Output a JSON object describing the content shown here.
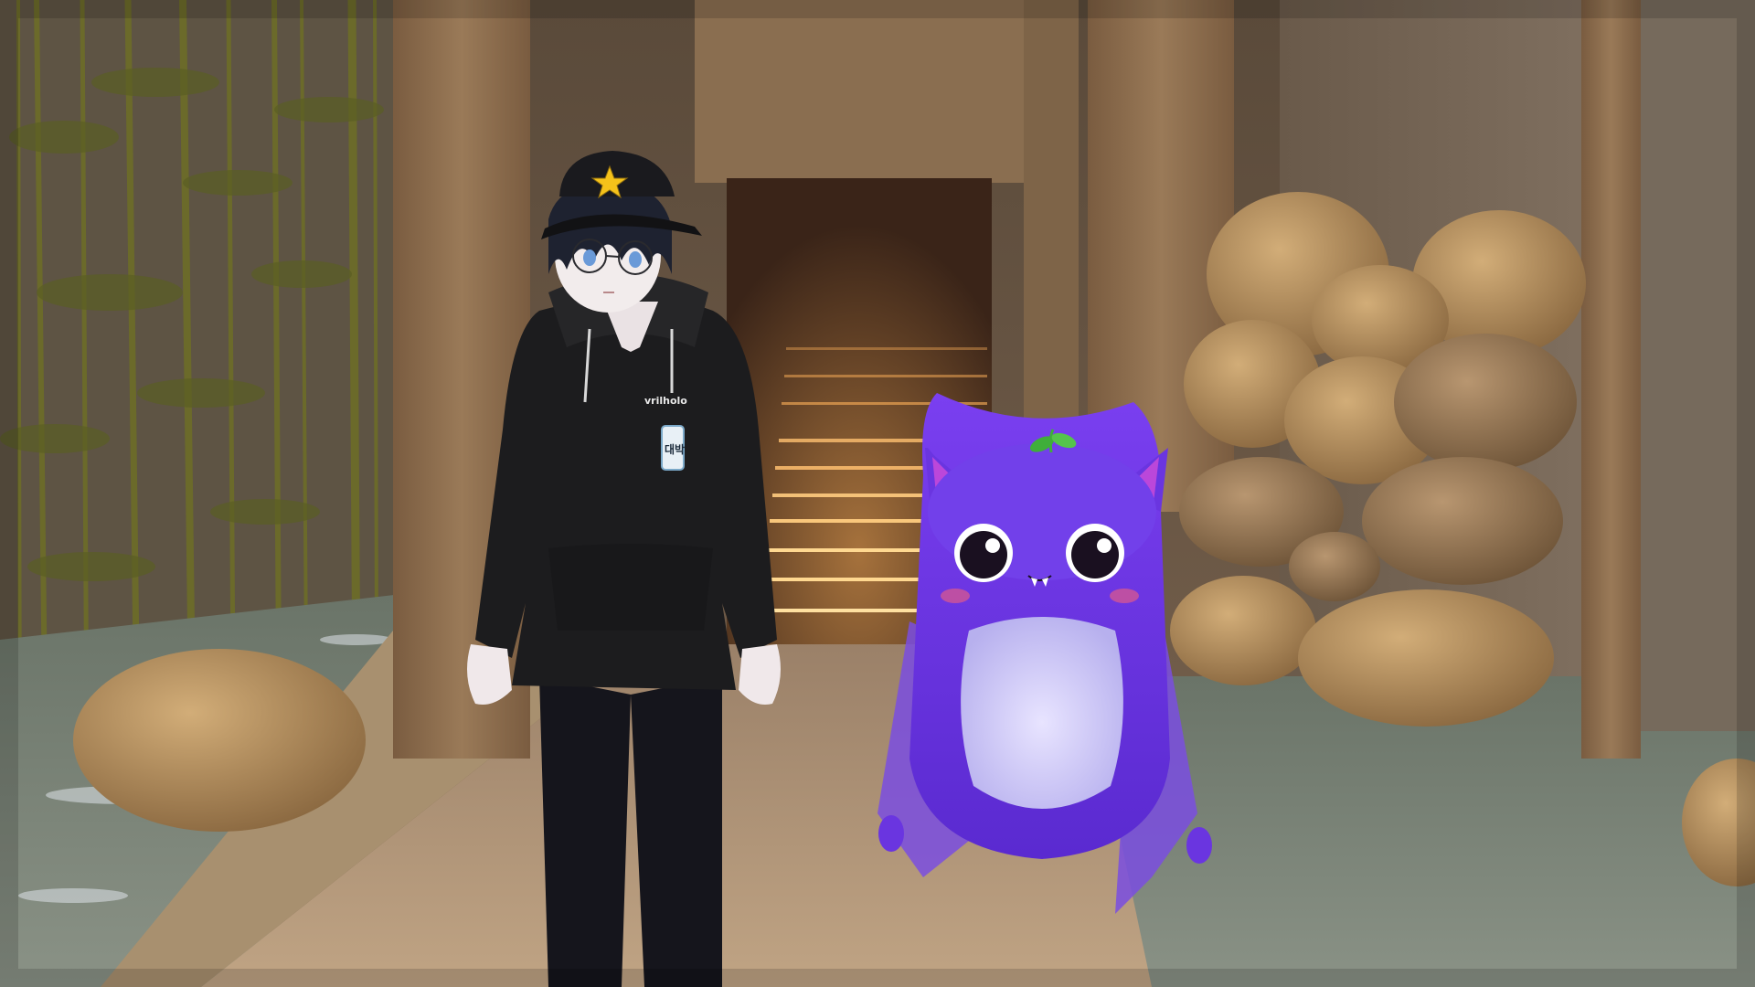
{
  "scene": {
    "setting": "indoor-bamboo-garden-with-stairway",
    "colors": {
      "wall": "#6f5a44",
      "pillar": "#8a6a4a",
      "floor_path": "#b89a78",
      "water": "#7a8478",
      "stair_glow": "#ffb25a",
      "rock": "#b08a5a",
      "bamboo": "#6b6a2a"
    }
  },
  "characters": {
    "boy": {
      "cap_icon": "star-icon",
      "hoodie_print": "vrilholo",
      "badge_text": "대박",
      "colors": {
        "cap": "#1a1a1e",
        "star": "#f5c21a",
        "hoodie": "#1c1c1e",
        "hair": "#1e2230",
        "skin": "#f2ecec",
        "eyes": "#6a9ad8"
      }
    },
    "bat_mascot": {
      "colors": {
        "body": "#6a35e0",
        "belly": "#c9c4f0",
        "ears_inner": "#d04cd8",
        "sprout": "#3fae3a",
        "blush": "#e05a8a"
      }
    }
  }
}
